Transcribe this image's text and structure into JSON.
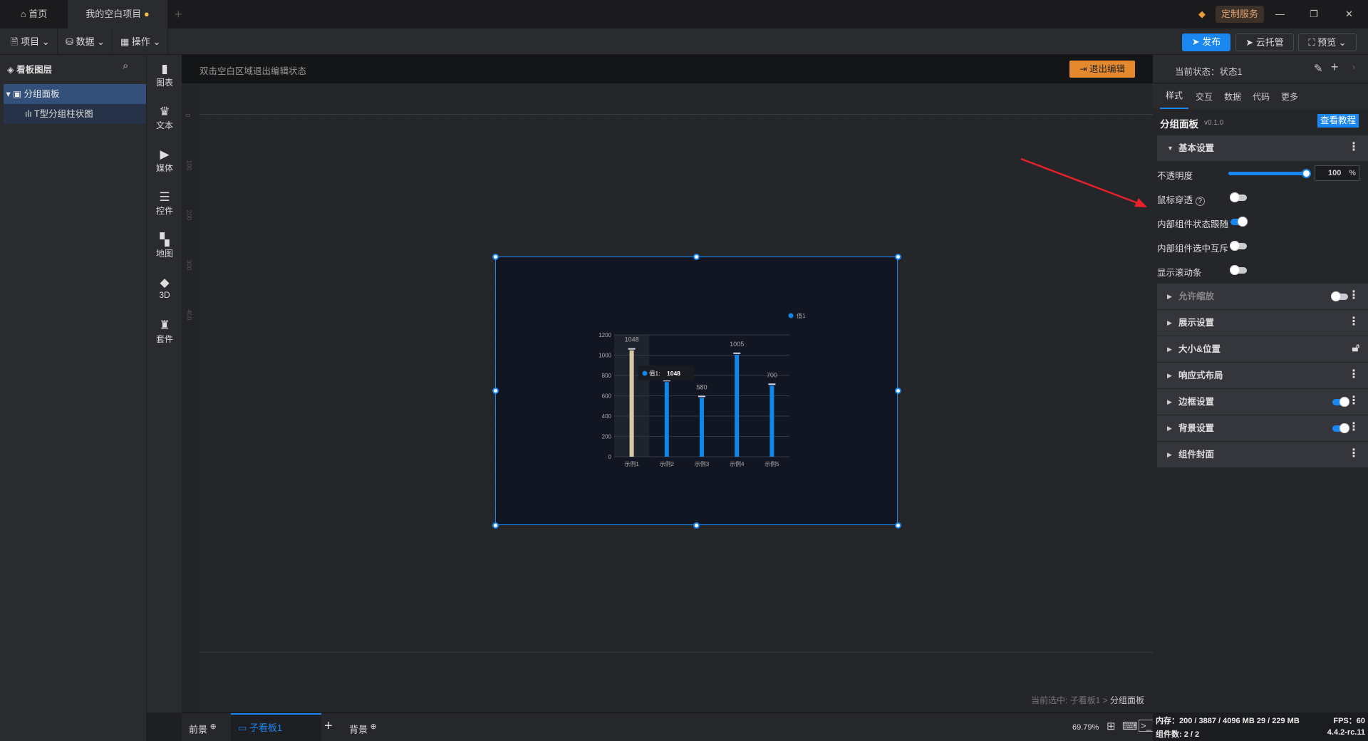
{
  "tabs": {
    "home": "首页",
    "project": "我的空白项目",
    "add": "+"
  },
  "topright": {
    "service": "定制服务",
    "minimize": "—",
    "restore": "❐",
    "close": "✕"
  },
  "toolbar": {
    "project": "项目",
    "data": "数据",
    "ops": "操作",
    "publish": "发布",
    "cloud": "云托管",
    "preview": "预览"
  },
  "layers": {
    "title": "看板图层",
    "items": [
      {
        "label": "分组面板"
      },
      {
        "label": "T型分组柱状图"
      }
    ]
  },
  "palette": [
    {
      "label": "图表",
      "icon": "▮"
    },
    {
      "label": "文本",
      "icon": "♛"
    },
    {
      "label": "媒体",
      "icon": "▶"
    },
    {
      "label": "控件",
      "icon": "☰"
    },
    {
      "label": "地图",
      "icon": "▚"
    },
    {
      "label": "3D",
      "icon": "◆"
    },
    {
      "label": "套件",
      "icon": "♜"
    }
  ],
  "ruler": [
    "0",
    "100",
    "200",
    "300",
    "400"
  ],
  "canvas": {
    "hint": "双击空白区域退出编辑状态",
    "exit": "退出编辑",
    "selected_path": "当前选中: 子看板1 > ",
    "selected_name": "分组面板"
  },
  "chart_data": {
    "type": "bar",
    "categories": [
      "示例1",
      "示例2",
      "示例3",
      "示例4",
      "示例5"
    ],
    "series": [
      {
        "name": "值1",
        "values": [
          1048,
          735,
          580,
          1005,
          700
        ]
      }
    ],
    "ylim": [
      0,
      1200
    ],
    "yticks": [
      "0",
      "200",
      "400",
      "600",
      "800",
      "1000",
      "1200"
    ],
    "tooltip": {
      "label": "值1:",
      "value": "1048"
    },
    "highlight_index": 0,
    "colors": {
      "bar": "#0f86e8",
      "highlight": "#d8cba3"
    }
  },
  "right": {
    "state": "当前状态：状态1",
    "tabs": [
      "样式",
      "交互",
      "数据",
      "代码",
      "更多"
    ],
    "title": "分组面板",
    "version": "v0.1.0",
    "tutorial": "查看教程",
    "basic": "基本设置",
    "opacity_label": "不透明度",
    "opacity_value": "100",
    "opacity_unit": "%",
    "opacity": 1.0,
    "settings": [
      {
        "label": "鼠标穿透",
        "on": false,
        "help": "?"
      },
      {
        "label": "内部组件状态跟随",
        "on": true
      },
      {
        "label": "内部组件选中互斥",
        "on": false
      },
      {
        "label": "显示滚动条",
        "on": false
      }
    ],
    "groups": [
      {
        "label": "允许缩放",
        "toggle": false
      },
      {
        "label": "展示设置"
      },
      {
        "label": "大小&位置",
        "lock": true
      },
      {
        "label": "响应式布局"
      },
      {
        "label": "边框设置",
        "toggle": true
      },
      {
        "label": "背景设置",
        "toggle": true
      },
      {
        "label": "组件封面"
      }
    ]
  },
  "bottom": {
    "front": "前景",
    "sub": "子看板1",
    "add": "+",
    "back": "背景",
    "zoom": "69.79%"
  },
  "status": {
    "memory": "内存：200 / 3887 / 4096 MB  29 / 229 MB",
    "fps": "FPS：60",
    "count": "组件数: 2 / 2",
    "version": "4.4.2-rc.11"
  }
}
